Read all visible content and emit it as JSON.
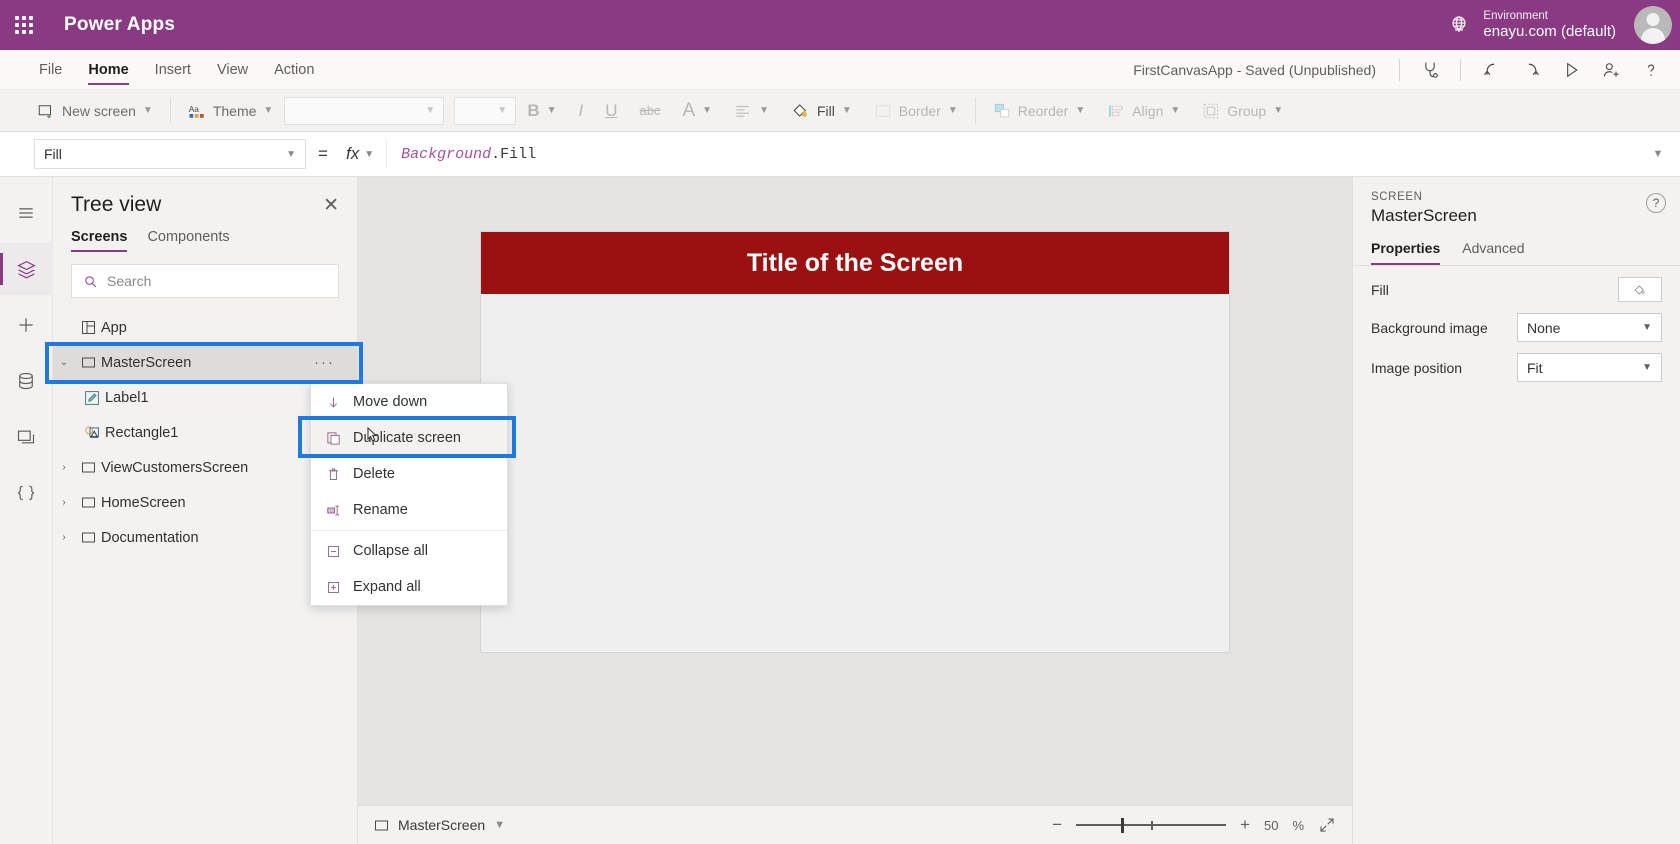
{
  "topbar": {
    "waffle_name": "app-launcher",
    "brand": "Power Apps",
    "environment_label": "Environment",
    "environment_value": "enayu.com (default)"
  },
  "menu": {
    "items": [
      {
        "label": "File",
        "active": false
      },
      {
        "label": "Home",
        "active": true
      },
      {
        "label": "Insert",
        "active": false
      },
      {
        "label": "View",
        "active": false
      },
      {
        "label": "Action",
        "active": false
      }
    ],
    "save_status": "FirstCanvasApp - Saved (Unpublished)",
    "icons": [
      "app-checker-icon",
      "undo-icon",
      "redo-icon",
      "preview-icon",
      "share-icon",
      "help-icon"
    ]
  },
  "ribbon": {
    "new_screen": "New screen",
    "theme": "Theme",
    "font_family_value": "",
    "font_size_value": "",
    "bold": "B",
    "italic": "I",
    "underline": "U",
    "strikethrough": "abc",
    "font_color": "A",
    "align": "align-icon",
    "fill": "Fill",
    "border": "Border",
    "reorder": "Reorder",
    "align_group": "Align",
    "group": "Group"
  },
  "formula": {
    "property": "Fill",
    "equals": "=",
    "fx": "fx",
    "expression_ident": "Background",
    "expression_rest": ".Fill"
  },
  "rail": {
    "items": [
      {
        "name": "hamburger-icon",
        "active": false
      },
      {
        "name": "tree-view-icon",
        "active": true
      },
      {
        "name": "insert-icon",
        "active": false
      },
      {
        "name": "data-icon",
        "active": false
      },
      {
        "name": "media-icon",
        "active": false
      },
      {
        "name": "variables-icon",
        "active": false
      }
    ]
  },
  "treeview": {
    "title": "Tree view",
    "close": "✕",
    "tabs": [
      {
        "label": "Screens",
        "active": true
      },
      {
        "label": "Components",
        "active": false
      }
    ],
    "search_placeholder": "Search",
    "search_value": "",
    "rows": [
      {
        "label": "App",
        "icon": "app-icon",
        "twisty": "",
        "indent": 0,
        "selected": false,
        "dots": false
      },
      {
        "label": "MasterScreen",
        "icon": "screen-icon",
        "twisty": "⌄",
        "indent": 0,
        "selected": true,
        "dots": true
      },
      {
        "label": "Label1",
        "icon": "label-icon",
        "twisty": "",
        "indent": 1,
        "selected": false,
        "dots": false
      },
      {
        "label": "Rectangle1",
        "icon": "shape-icon",
        "twisty": "",
        "indent": 1,
        "selected": false,
        "dots": false
      },
      {
        "label": "ViewCustomersScreen",
        "icon": "screen-icon",
        "twisty": "›",
        "indent": 0,
        "selected": false,
        "dots": false
      },
      {
        "label": "HomeScreen",
        "icon": "screen-icon",
        "twisty": "›",
        "indent": 0,
        "selected": false,
        "dots": false
      },
      {
        "label": "Documentation",
        "icon": "screen-icon",
        "twisty": "›",
        "indent": 0,
        "selected": false,
        "dots": false
      }
    ]
  },
  "context_menu": {
    "items": [
      {
        "label": "Move down",
        "icon": "arrow-down-icon",
        "hover": false,
        "sep_after": false
      },
      {
        "label": "Duplicate screen",
        "icon": "duplicate-icon",
        "hover": true,
        "sep_after": false
      },
      {
        "label": "Delete",
        "icon": "trash-icon",
        "hover": false,
        "sep_after": false
      },
      {
        "label": "Rename",
        "icon": "rename-icon",
        "hover": false,
        "sep_after": true
      },
      {
        "label": "Collapse all",
        "icon": "collapse-icon",
        "hover": false,
        "sep_after": false
      },
      {
        "label": "Expand all",
        "icon": "expand-icon",
        "hover": false,
        "sep_after": false
      }
    ]
  },
  "canvas": {
    "screen_title": "Title of the Screen",
    "title_bar_color": "#9b1111",
    "screen_fill": "#efefef"
  },
  "statusbar": {
    "screen_name": "MasterScreen",
    "minus": "−",
    "plus": "+",
    "zoom_value": "50",
    "zoom_unit": "%",
    "fit_icon": "fit-screen-icon"
  },
  "properties_panel": {
    "kicker": "SCREEN",
    "title": "MasterScreen",
    "help": "?",
    "tabs": [
      {
        "label": "Properties",
        "active": true
      },
      {
        "label": "Advanced",
        "active": false
      }
    ],
    "rows": [
      {
        "label": "Fill",
        "control": "swatch",
        "value": ""
      },
      {
        "label": "Background image",
        "control": "select",
        "value": "None"
      },
      {
        "label": "Image position",
        "control": "select",
        "value": "Fit"
      }
    ]
  },
  "highlights": {
    "accent_color": "#1f7ae0",
    "boxes": [
      "tree-row-masterscreen",
      "context-item-duplicate-screen"
    ]
  }
}
